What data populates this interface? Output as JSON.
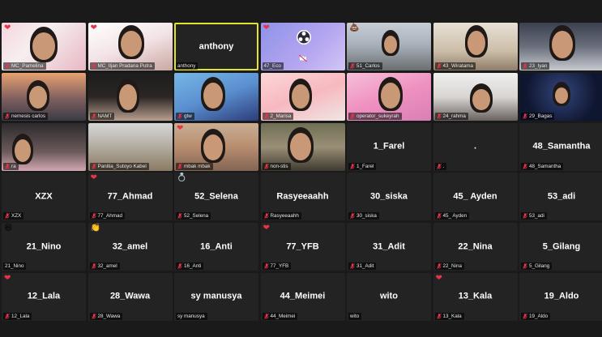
{
  "colors": {
    "background": "#1a1a1a",
    "tile": "#232323",
    "active_border": "#e3e327",
    "muted_mic": "#e8344b",
    "heart": "#e8344b"
  },
  "participants": [
    {
      "label": "MC_Pamelina",
      "big": "",
      "video": true,
      "muted": true,
      "reaction": "heart"
    },
    {
      "label": "MC_Iljan Pradana Putra",
      "big": "",
      "video": true,
      "muted": true,
      "reaction": "heart"
    },
    {
      "label": "anthony",
      "big": "anthony",
      "video": false,
      "muted": false,
      "reaction": "",
      "active": true
    },
    {
      "label": "47_Eco",
      "big": "",
      "video": true,
      "muted": false,
      "reaction": "heart",
      "cam_off_icon": true
    },
    {
      "label": "51_Carlos",
      "big": "",
      "video": true,
      "muted": true,
      "reaction": "poop"
    },
    {
      "label": "43_Wiratama",
      "big": "",
      "video": true,
      "muted": true,
      "reaction": ""
    },
    {
      "label": "23_Iyan",
      "big": "",
      "video": true,
      "muted": true,
      "reaction": ""
    },
    {
      "label": "nemesis carlos",
      "big": "",
      "video": true,
      "muted": true,
      "reaction": ""
    },
    {
      "label": "NAMT",
      "big": "",
      "video": true,
      "muted": true,
      "reaction": ""
    },
    {
      "label": "gtw",
      "big": "",
      "video": true,
      "muted": true,
      "reaction": ""
    },
    {
      "label": "2_Marisa",
      "big": "",
      "video": true,
      "muted": true,
      "reaction": ""
    },
    {
      "label": "operator_sukeyrah",
      "big": "",
      "video": true,
      "muted": true,
      "reaction": ""
    },
    {
      "label": "24_rahma",
      "big": "",
      "video": true,
      "muted": true,
      "reaction": ""
    },
    {
      "label": "29_Bagas",
      "big": "",
      "video": true,
      "muted": true,
      "reaction": ""
    },
    {
      "label": "ra",
      "big": "",
      "video": true,
      "muted": true,
      "reaction": ""
    },
    {
      "label": "Panitia_Sutoyo Kabel",
      "big": "",
      "video": true,
      "muted": true,
      "reaction": ""
    },
    {
      "label": "mbak mbak",
      "big": "",
      "video": true,
      "muted": true,
      "reaction": "heart"
    },
    {
      "label": "non-stis",
      "big": "",
      "video": true,
      "muted": true,
      "reaction": ""
    },
    {
      "label": "1_Farel",
      "big": "1_Farel",
      "video": false,
      "muted": true,
      "reaction": ""
    },
    {
      "label": ".",
      "big": ".",
      "video": false,
      "muted": true,
      "reaction": ""
    },
    {
      "label": "48_Samantha",
      "big": "48_Samantha",
      "video": false,
      "muted": true,
      "reaction": ""
    },
    {
      "label": "XZX",
      "big": "XZX",
      "video": false,
      "muted": true,
      "reaction": ""
    },
    {
      "label": "77_Ahmad",
      "big": "77_Ahmad",
      "video": false,
      "muted": true,
      "reaction": "heart"
    },
    {
      "label": "52_Selena",
      "big": "52_Selena",
      "video": false,
      "muted": true,
      "reaction": "ring"
    },
    {
      "label": "Rasyeeaahh",
      "big": "Rasyeeaahh",
      "video": false,
      "muted": true,
      "reaction": ""
    },
    {
      "label": "30_siska",
      "big": "30_siska",
      "video": false,
      "muted": true,
      "reaction": ""
    },
    {
      "label": "45_ Ayden",
      "big": "45_ Ayden",
      "video": false,
      "muted": true,
      "reaction": ""
    },
    {
      "label": "53_adi",
      "big": "53_adi",
      "video": false,
      "muted": true,
      "reaction": ""
    },
    {
      "label": "21_Nino",
      "big": "21_Nino",
      "video": false,
      "muted": false,
      "reaction": "laugh"
    },
    {
      "label": "32_amel",
      "big": "32_amel",
      "video": false,
      "muted": true,
      "reaction": "clap"
    },
    {
      "label": "16_Anti",
      "big": "16_Anti",
      "video": false,
      "muted": true,
      "reaction": ""
    },
    {
      "label": "77_YFB",
      "big": "77_YFB",
      "video": false,
      "muted": true,
      "reaction": "heart"
    },
    {
      "label": "31_Adit",
      "big": "31_Adit",
      "video": false,
      "muted": true,
      "reaction": ""
    },
    {
      "label": "22_Nina",
      "big": "22_Nina",
      "video": false,
      "muted": true,
      "reaction": ""
    },
    {
      "label": "5_Gilang",
      "big": "5_Gilang",
      "video": false,
      "muted": true,
      "reaction": ""
    },
    {
      "label": "12_Lala",
      "big": "12_Lala",
      "video": false,
      "muted": true,
      "reaction": "heart"
    },
    {
      "label": "28_Wawa",
      "big": "28_Wawa",
      "video": false,
      "muted": true,
      "reaction": ""
    },
    {
      "label": "sy manusya",
      "big": "sy manusya",
      "video": false,
      "muted": false,
      "reaction": ""
    },
    {
      "label": "44_Meimei",
      "big": "44_Meimei",
      "video": false,
      "muted": true,
      "reaction": ""
    },
    {
      "label": "wito",
      "big": "wito",
      "video": false,
      "muted": false,
      "reaction": ""
    },
    {
      "label": "13_Kala",
      "big": "13_Kala",
      "video": false,
      "muted": true,
      "reaction": "heart"
    },
    {
      "label": "19_Aldo",
      "big": "19_Aldo",
      "video": false,
      "muted": true,
      "reaction": ""
    }
  ]
}
